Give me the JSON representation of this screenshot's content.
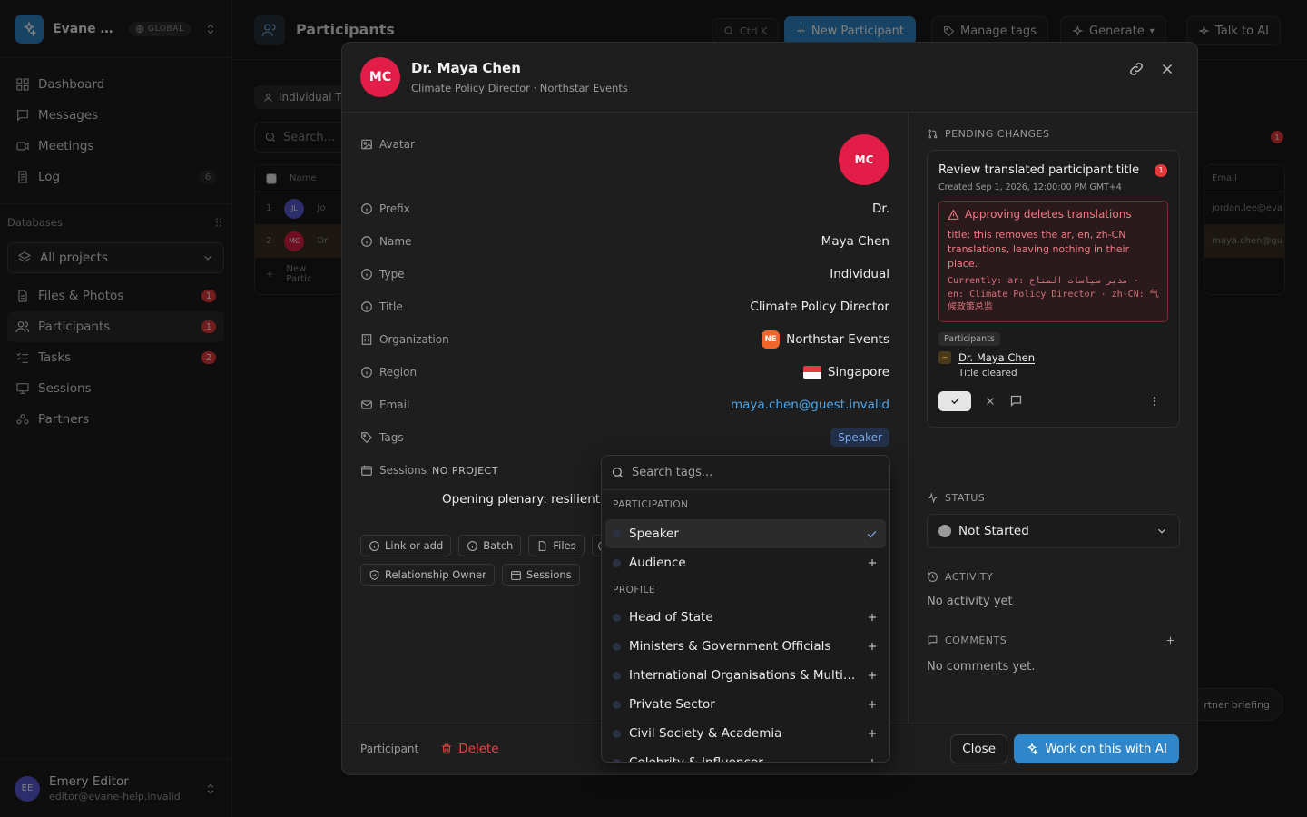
{
  "sidebar": {
    "workspace_name": "Evane Help",
    "workspace_badge": "GLOBAL",
    "nav": [
      {
        "label": "Dashboard",
        "icon": "dashboard-icon"
      },
      {
        "label": "Messages",
        "icon": "message-icon"
      },
      {
        "label": "Meetings",
        "icon": "video-icon"
      },
      {
        "label": "Log",
        "icon": "log-icon",
        "count": "6"
      }
    ],
    "databases_label": "Databases",
    "project_select": "All projects",
    "db_items": [
      {
        "label": "Files & Photos",
        "badge": "1"
      },
      {
        "label": "Participants",
        "badge": "1"
      },
      {
        "label": "Tasks",
        "badge": "2"
      },
      {
        "label": "Sessions"
      },
      {
        "label": "Partners"
      }
    ],
    "user": {
      "initials": "EE",
      "name": "Emery Editor",
      "email": "editor@evane-help.invalid"
    }
  },
  "page": {
    "title": "Participants",
    "search_shortcut": "Ctrl K",
    "new_button": "New Participant",
    "manage_tags": "Manage tags",
    "generate": "Generate",
    "talk_ai": "Talk to AI",
    "filter_chip": "Individual T",
    "search_placeholder": "Search...",
    "table_header_name": "Name",
    "row1_num": "1",
    "row1_initials": "JL",
    "row1_name": "Jo",
    "row2_num": "2",
    "row2_initials": "MC",
    "row2_name": "Dr",
    "new_row": "New Partic",
    "right_header": "Email",
    "right_row1": "jordan.lee@eva",
    "right_row2": "maya.chen@gu",
    "bg_badge": "1",
    "bg_pill": "rtner briefing"
  },
  "modal": {
    "initials": "MC",
    "name": "Dr. Maya Chen",
    "subtitle": "Climate Policy Director · Northstar Events",
    "fields": {
      "avatar_label": "Avatar",
      "avatar_initials": "MC",
      "prefix_label": "Prefix",
      "prefix": "Dr.",
      "name_label": "Name",
      "name": "Maya Chen",
      "type_label": "Type",
      "type": "Individual",
      "title_label": "Title",
      "title": "Climate Policy Director",
      "org_label": "Organization",
      "org_badge": "NE",
      "org": "Northstar Events",
      "region_label": "Region",
      "region": "Singapore",
      "email_label": "Email",
      "email": "maya.chen@guest.invalid",
      "tags_label": "Tags",
      "tag": "Speaker",
      "sessions_label": "Sessions",
      "no_project": "NO PROJECT",
      "session_title": "Opening plenary: resilient f"
    },
    "chips": {
      "link": "Link or add",
      "batch": "Batch",
      "files": "Files",
      "owner": "Relationship Owner",
      "sessions": "Sessions"
    },
    "footer": {
      "label": "Participant",
      "delete": "Delete",
      "close": "Close",
      "ai": "Work on this with AI"
    },
    "pending": {
      "header": "PENDING CHANGES",
      "title": "Review translated participant title",
      "badge": "1",
      "created": "Created Sep 1, 2026, 12:00:00 PM GMT+4",
      "warn_title": "Approving deletes translations",
      "warn_body": "title: this removes the ar, en, zh-CN translations, leaving nothing in their place.",
      "warn_mono": "Currently: ar: مدير سياسات المناخ · en: Climate Policy Director · zh-CN: 气候政策总监",
      "tag": "Participants",
      "person": "Dr. Maya Chen",
      "person_icon": "~",
      "note": "Title cleared"
    },
    "status": {
      "header": "STATUS",
      "value": "Not Started"
    },
    "activity": {
      "header": "ACTIVITY",
      "empty": "No activity yet"
    },
    "comments": {
      "header": "COMMENTS",
      "empty": "No comments yet."
    }
  },
  "dropdown": {
    "search_placeholder": "Search tags...",
    "group1": "PARTICIPATION",
    "group1_items": [
      {
        "label": "Speaker",
        "selected": true
      },
      {
        "label": "Audience",
        "selected": false
      }
    ],
    "group2": "PROFILE",
    "group2_items": [
      {
        "label": "Head of State"
      },
      {
        "label": "Ministers & Government Officials"
      },
      {
        "label": "International Organisations & Multilateral"
      },
      {
        "label": "Private Sector"
      },
      {
        "label": "Civil Society & Academia"
      },
      {
        "label": "Celebrity & Influencer"
      }
    ]
  }
}
